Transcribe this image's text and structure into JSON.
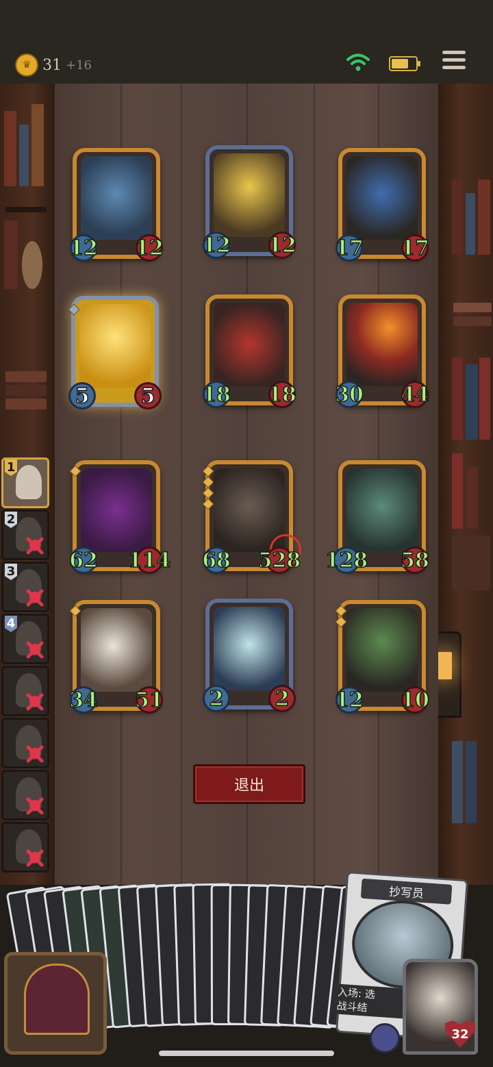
{
  "status_bar": {
    "gold": "31",
    "gold_income": "+16",
    "icons": [
      "crown-coin-icon",
      "wifi-icon",
      "battery-icon",
      "menu-icon"
    ]
  },
  "board": {
    "minions": [
      {
        "id": "blue-dragon",
        "attack": "12",
        "health": "12",
        "frame": "gold"
      },
      {
        "id": "golden-horned-lord",
        "attack": "12",
        "health": "12",
        "frame": "blue"
      },
      {
        "id": "armored-dragon",
        "attack": "17",
        "health": "17",
        "frame": "gold"
      },
      {
        "id": "golden-elemental",
        "attack": "5",
        "health": "5",
        "frame": "golden"
      },
      {
        "id": "red-demon",
        "attack": "18",
        "health": "18",
        "frame": "gold"
      },
      {
        "id": "fire-demon",
        "attack": "30",
        "health": "44",
        "frame": "gold"
      },
      {
        "id": "purple-boar",
        "attack": "62",
        "health": "114",
        "frame": "gold"
      },
      {
        "id": "pirate-brute",
        "attack": "68",
        "health": "528",
        "frame": "gold"
      },
      {
        "id": "green-parrot",
        "attack": "128",
        "health": "58",
        "frame": "gold"
      },
      {
        "id": "patchwork-cow",
        "attack": "34",
        "health": "51",
        "frame": "gold"
      },
      {
        "id": "fairy",
        "attack": "2",
        "health": "2",
        "frame": "blue"
      },
      {
        "id": "feathered-shaman",
        "attack": "12",
        "health": "10",
        "frame": "gold"
      }
    ]
  },
  "exit_button": {
    "label": "退出"
  },
  "leaderboard": {
    "players": [
      {
        "rank": "1",
        "eliminated": false
      },
      {
        "rank": "2",
        "eliminated": true
      },
      {
        "rank": "3",
        "eliminated": true
      },
      {
        "rank": "4",
        "eliminated": true
      },
      {
        "rank": "",
        "eliminated": true
      },
      {
        "rank": "",
        "eliminated": true
      },
      {
        "rank": "",
        "eliminated": true
      },
      {
        "rank": "",
        "eliminated": true
      }
    ]
  },
  "hand": {
    "preview_card": {
      "name": "抄写员",
      "text_line1": "入场: 选",
      "text_line2": "战斗结"
    }
  },
  "hero": {
    "health": "32"
  },
  "colors": {
    "accent_gold": "#c9892f",
    "stat_text": "#a8f27a",
    "exit_red": "#7e1a1a"
  }
}
